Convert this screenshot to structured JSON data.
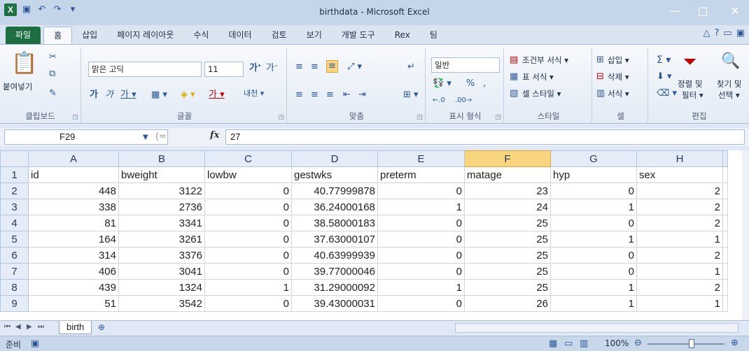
{
  "window": {
    "title": "birthdata - Microsoft Excel",
    "logo": "X"
  },
  "tabs": {
    "file": "파일",
    "items": [
      "홈",
      "삽입",
      "페이지 레이아웃",
      "수식",
      "데이터",
      "검토",
      "보기",
      "개발 도구",
      "Rex",
      "팀"
    ]
  },
  "ribbon": {
    "clipboard": {
      "paste": "붙여넣기",
      "label": "클립보드"
    },
    "font": {
      "name": "맑은 고딕",
      "size": "11",
      "label": "글꼴"
    },
    "alignment": {
      "label": "맞춤"
    },
    "number": {
      "format": "일반",
      "label": "표시 형식"
    },
    "styles": {
      "conditional": "조건부 서식 ▾",
      "table": "표 서식 ▾",
      "cell": "셀 스타일 ▾",
      "label": "스타일"
    },
    "cells": {
      "insert": "삽입 ▾",
      "delete": "삭제 ▾",
      "format": "서식 ▾",
      "label": "셀"
    },
    "editing": {
      "sort": "정렬 및",
      "sort2": "필터 ▾",
      "find": "찾기 및",
      "find2": "선택 ▾",
      "label": "편집"
    }
  },
  "formula_bar": {
    "cell_ref": "F29",
    "fx": "fx",
    "value": "27"
  },
  "grid": {
    "columns": [
      "A",
      "B",
      "C",
      "D",
      "E",
      "F",
      "G",
      "H"
    ],
    "selected_column": "F",
    "rows": [
      {
        "n": "1",
        "cells": [
          "id",
          "bweight",
          "lowbw",
          "gestwks",
          "preterm",
          "matage",
          "hyp",
          "sex"
        ],
        "header": true
      },
      {
        "n": "2",
        "cells": [
          "448",
          "3122",
          "0",
          "40.77999878",
          "0",
          "23",
          "0",
          "2"
        ]
      },
      {
        "n": "3",
        "cells": [
          "338",
          "2736",
          "0",
          "36.24000168",
          "1",
          "24",
          "1",
          "2"
        ]
      },
      {
        "n": "4",
        "cells": [
          "81",
          "3341",
          "0",
          "38.58000183",
          "0",
          "25",
          "0",
          "2"
        ]
      },
      {
        "n": "5",
        "cells": [
          "164",
          "3261",
          "0",
          "37.63000107",
          "0",
          "25",
          "1",
          "1"
        ]
      },
      {
        "n": "6",
        "cells": [
          "314",
          "3376",
          "0",
          "40.63999939",
          "0",
          "25",
          "0",
          "2"
        ]
      },
      {
        "n": "7",
        "cells": [
          "406",
          "3041",
          "0",
          "39.77000046",
          "0",
          "25",
          "0",
          "1"
        ]
      },
      {
        "n": "8",
        "cells": [
          "439",
          "1324",
          "1",
          "31.29000092",
          "1",
          "25",
          "1",
          "2"
        ]
      },
      {
        "n": "9",
        "cells": [
          "51",
          "3542",
          "0",
          "39.43000031",
          "0",
          "26",
          "1",
          "1"
        ]
      }
    ]
  },
  "sheets": {
    "active": "birth"
  },
  "status": {
    "ready": "준비",
    "zoom": "100%"
  }
}
